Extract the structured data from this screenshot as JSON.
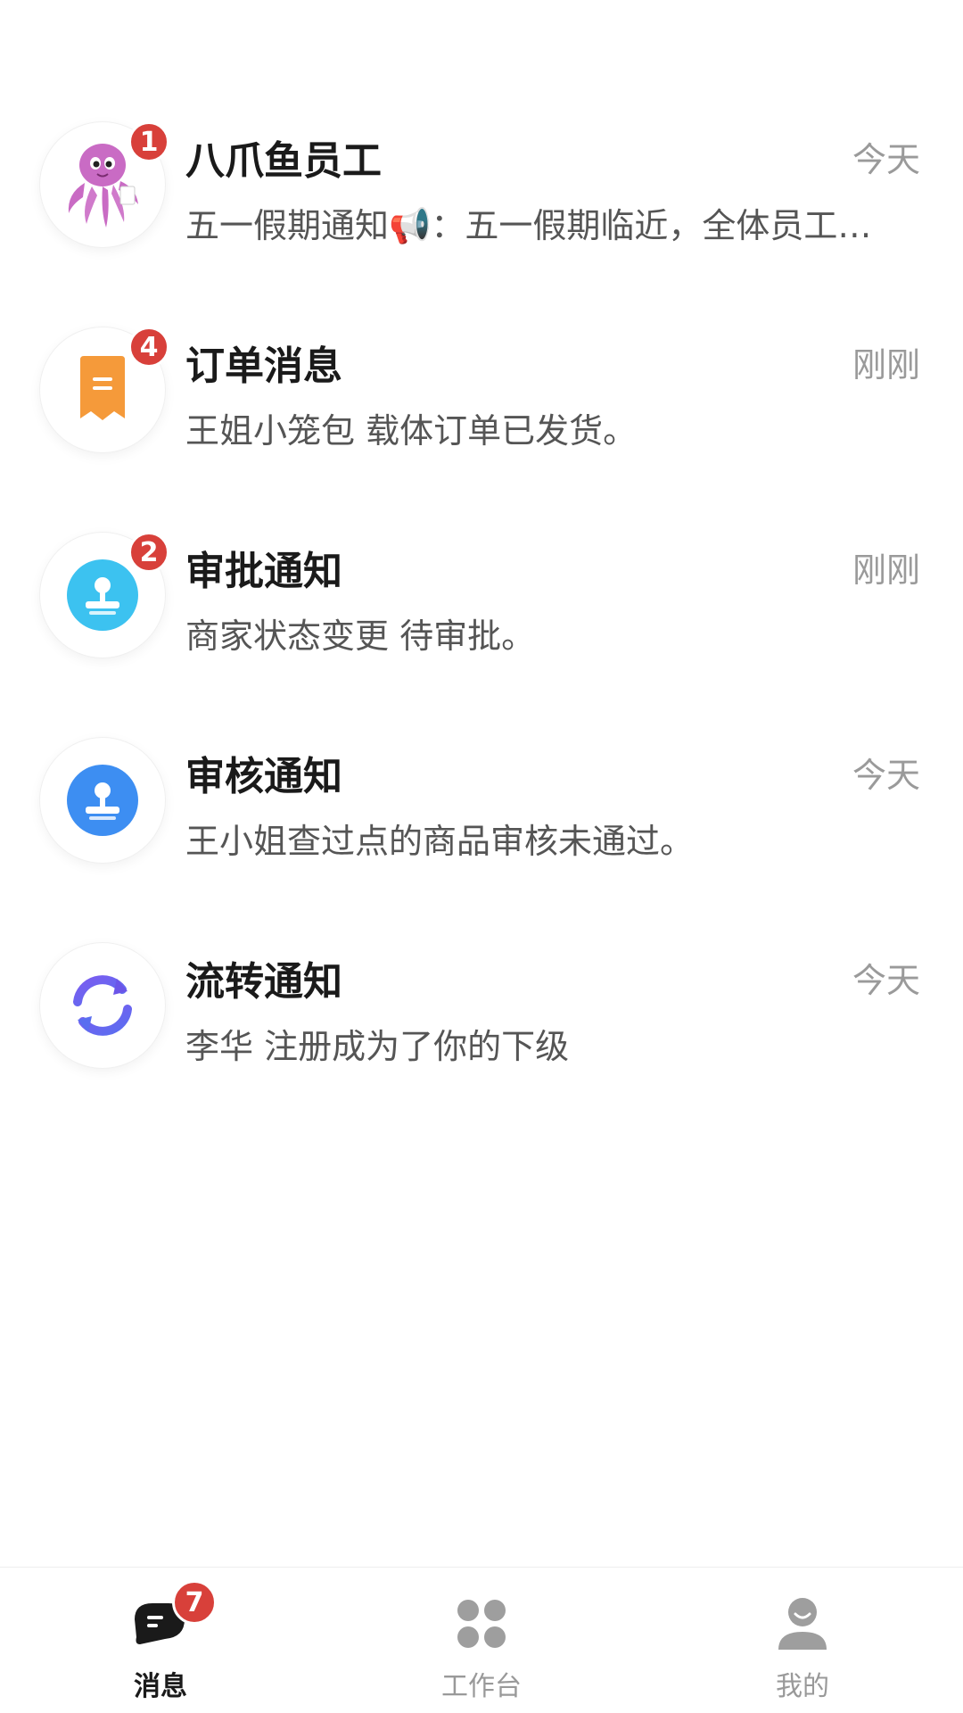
{
  "messages": [
    {
      "title": "八爪鱼员工",
      "preview": "五一假期通知📢：五一假期临近，全体员工…",
      "time": "今天",
      "badge": "1",
      "icon": "octopus-avatar"
    },
    {
      "title": "订单消息",
      "preview": "王姐小笼包 载体订单已发货。",
      "time": "刚刚",
      "badge": "4",
      "icon": "receipt-icon",
      "icon_color": "#f59a3a"
    },
    {
      "title": "审批通知",
      "preview": "商家状态变更 待审批。",
      "time": "刚刚",
      "badge": "2",
      "icon": "stamp-icon",
      "icon_color": "#3cc2f0"
    },
    {
      "title": "审核通知",
      "preview": "王小姐查过点的商品审核未通过。",
      "time": "今天",
      "badge": "",
      "icon": "stamp-icon",
      "icon_color": "#3d8ef2"
    },
    {
      "title": "流转通知",
      "preview": "李华 注册成为了你的下级",
      "time": "今天",
      "badge": "",
      "icon": "refresh-icon",
      "icon_color": "#6b55e8"
    }
  ],
  "tabbar": {
    "tabs": [
      {
        "label": "消息",
        "icon": "message-icon",
        "badge": "7",
        "active": true
      },
      {
        "label": "工作台",
        "icon": "workbench-icon",
        "badge": "",
        "active": false
      },
      {
        "label": "我的",
        "icon": "profile-icon",
        "badge": "",
        "active": false
      }
    ]
  },
  "colors": {
    "badge": "#d8403a",
    "title": "#1a1a1a",
    "preview": "#555555",
    "time": "#9a9a9a",
    "tab_inactive": "#999999"
  }
}
